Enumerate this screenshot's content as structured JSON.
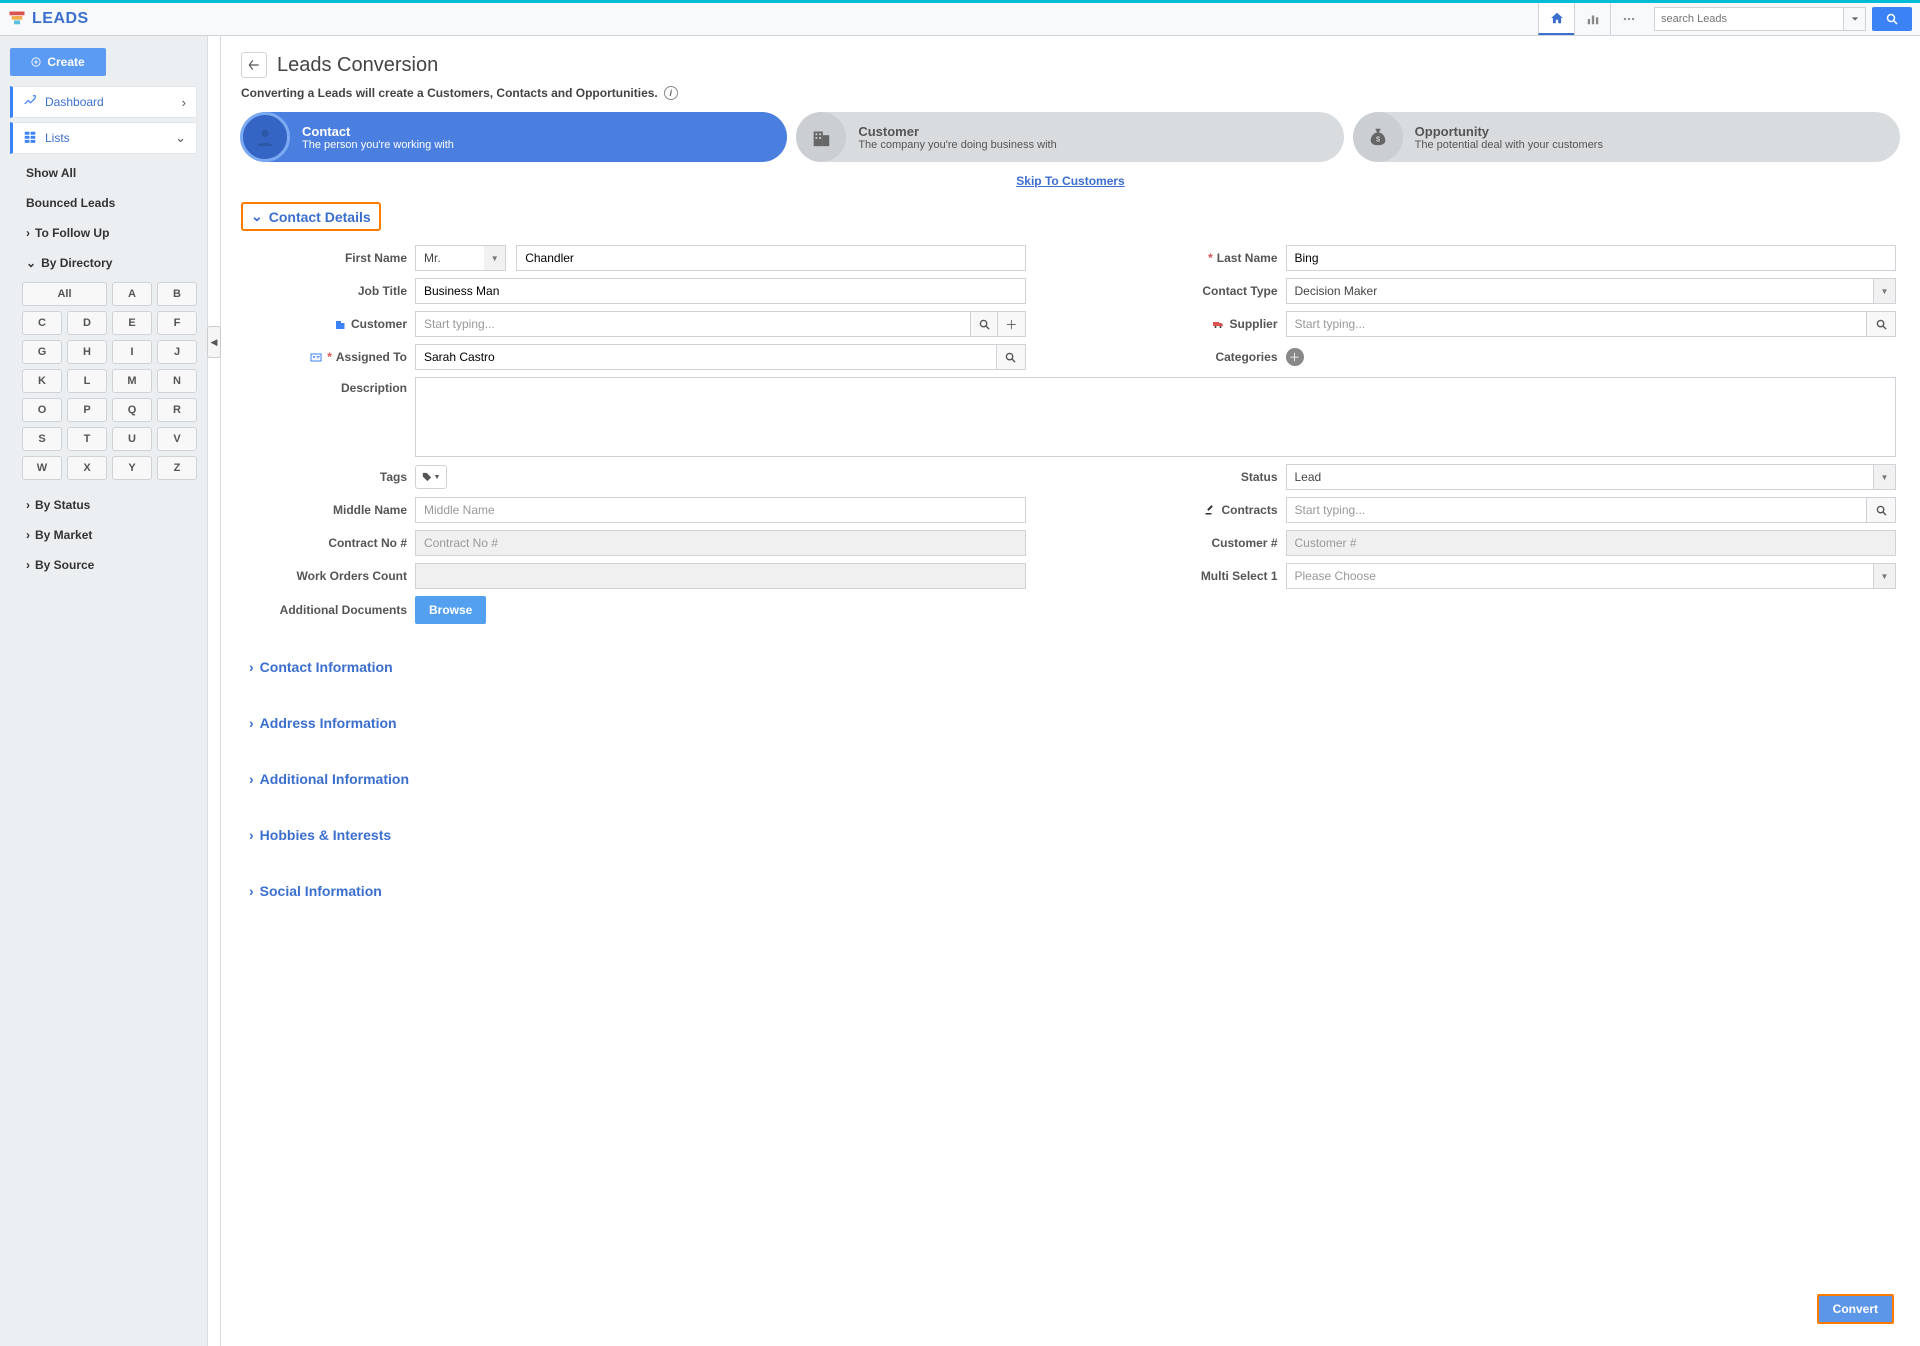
{
  "header": {
    "app": "LEADS",
    "search_placeholder": "search Leads"
  },
  "sidebar": {
    "create": "Create",
    "nav": {
      "dashboard": "Dashboard",
      "lists": "Lists"
    },
    "list_subs": {
      "show_all": "Show All",
      "bounced": "Bounced Leads",
      "followup": "To Follow Up",
      "directory": "By Directory",
      "status": "By Status",
      "market": "By Market",
      "source": "By Source"
    },
    "alpha": [
      "All",
      "A",
      "B",
      "C",
      "D",
      "E",
      "F",
      "G",
      "H",
      "I",
      "J",
      "K",
      "L",
      "M",
      "N",
      "O",
      "P",
      "Q",
      "R",
      "S",
      "T",
      "U",
      "V",
      "W",
      "X",
      "Y",
      "Z"
    ]
  },
  "page": {
    "title": "Leads Conversion",
    "subtitle": "Converting a Leads will create a Customers, Contacts and Opportunities.",
    "skip": "Skip To Customers"
  },
  "wizard": [
    {
      "title": "Contact",
      "sub": "The person you're working with"
    },
    {
      "title": "Customer",
      "sub": "The company you're doing business with"
    },
    {
      "title": "Opportunity",
      "sub": "The potential deal with your customers"
    }
  ],
  "sect": {
    "details": "Contact Details",
    "info": "Contact Information",
    "address": "Address Information",
    "additional": "Additional Information",
    "hobbies": "Hobbies & Interests",
    "social": "Social Information"
  },
  "labels": {
    "first_name": "First Name",
    "last_name": "Last Name",
    "job_title": "Job Title",
    "contact_type": "Contact Type",
    "customer": "Customer",
    "supplier": "Supplier",
    "assigned_to": "Assigned To",
    "categories": "Categories",
    "description": "Description",
    "tags": "Tags",
    "status": "Status",
    "middle_name": "Middle Name",
    "contracts": "Contracts",
    "contract_no": "Contract No #",
    "customer_no": "Customer #",
    "work_orders": "Work Orders Count",
    "multi_select": "Multi Select 1",
    "add_docs": "Additional Documents",
    "browse": "Browse",
    "convert": "Convert"
  },
  "ph": {
    "start_typing": "Start typing...",
    "middle_name": "Middle Name",
    "contract_no": "Contract No #",
    "customer_no": "Customer #",
    "please_choose": "Please Choose"
  },
  "values": {
    "title": "Mr.",
    "first_name": "Chandler",
    "last_name": "Bing",
    "job_title": "Business Man",
    "contact_type": "Decision Maker",
    "assigned_to": "Sarah Castro",
    "status": "Lead"
  }
}
